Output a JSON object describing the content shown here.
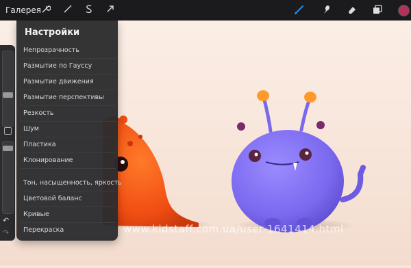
{
  "topbar": {
    "gallery_label": "Галерея",
    "left_icons": [
      "wrench-icon",
      "magic-wand-icon",
      "selection-s-icon",
      "arrow-cursor-icon"
    ],
    "right_icons": [
      "brush-icon",
      "smudge-icon",
      "eraser-icon",
      "layers-icon",
      "color-swatch"
    ],
    "accent_color": "#1f8ef1",
    "swatch_color": "#b0335a"
  },
  "menu": {
    "title": "Настройки",
    "items": [
      "Непрозрачность",
      "Размытие по Гауссу",
      "Размытие движения",
      "Размытие перспективы",
      "Резкость",
      "Шум",
      "Пластика",
      "Клонирование",
      "Тон, насыщенность, яркость",
      "Цветовой баланс",
      "Кривые",
      "Перекраска"
    ]
  },
  "canvas": {
    "watermark": "www.kidstaff.com.ua/user-1641414.html"
  }
}
